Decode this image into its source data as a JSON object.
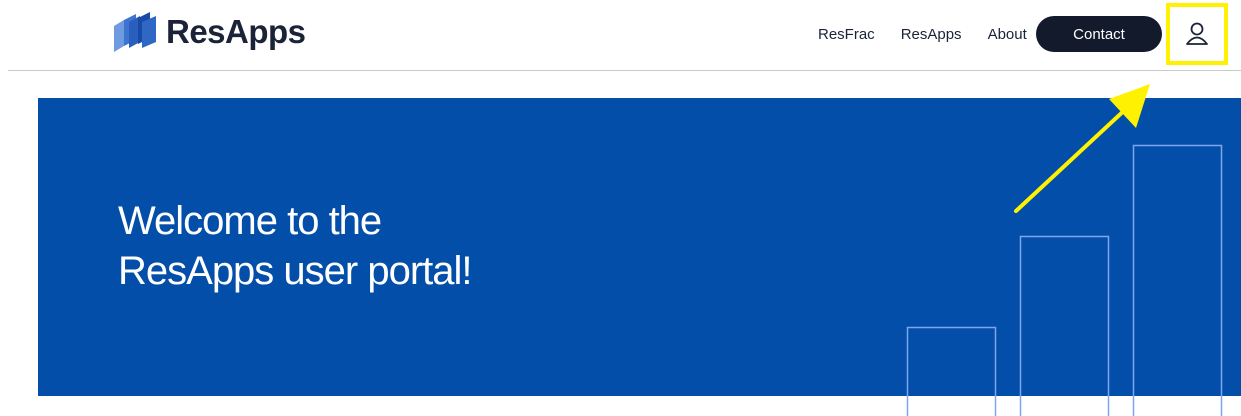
{
  "header": {
    "brand": "ResApps",
    "nav": [
      {
        "label": "ResFrac"
      },
      {
        "label": "ResApps"
      },
      {
        "label": "About"
      }
    ],
    "contact_label": "Contact",
    "user_icon": "user-icon"
  },
  "hero": {
    "title_line1": "Welcome to the",
    "title_line2": "ResApps user portal!"
  },
  "colors": {
    "hero_bg": "#034ea8",
    "contact_bg": "#121a2b",
    "highlight": "#fff200",
    "brand_text": "#1b2338"
  }
}
